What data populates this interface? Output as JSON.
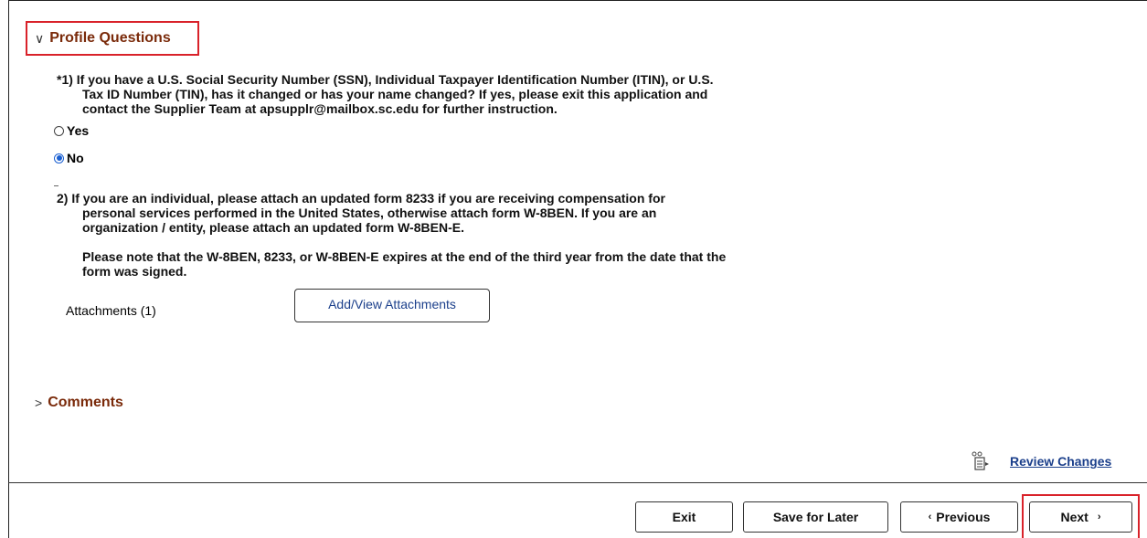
{
  "profile": {
    "title": "Profile Questions",
    "q1": {
      "line1": "*1) If you have a U.S. Social Security Number (SSN), Individual Taxpayer Identification Number (ITIN), or U.S.",
      "line2": "Tax ID Number (TIN), has it changed or has your name changed?  If yes, please exit this application and",
      "line3": "contact the Supplier Team at apsupplr@mailbox.sc.edu for further instruction.",
      "options": [
        "Yes",
        "No"
      ],
      "selected": "No"
    },
    "q2": {
      "line1": "2) If you are an individual, please attach an updated form 8233 if you are receiving compensation for",
      "line2": "personal services performed in the United States, otherwise attach form W-8BEN.  If you are an",
      "line3": "organization / entity, please attach an updated form W-8BEN-E.",
      "note1": "Please note that the W-8BEN, 8233, or W-8BEN-E expires at the end of the third year from the date that the",
      "note2": "form was signed."
    },
    "attachments_label": "Attachments (1)",
    "attachments_button": "Add/View Attachments"
  },
  "comments": {
    "title": "Comments"
  },
  "review_changes": "Review Changes",
  "footer": {
    "exit": "Exit",
    "save_later": "Save for Later",
    "previous": "Previous",
    "next": "Next"
  },
  "colors": {
    "section_title": "#7a2a0a",
    "link": "#1b3f8b",
    "highlight": "#d9222a",
    "radio_selected": "#1a5fd1"
  }
}
